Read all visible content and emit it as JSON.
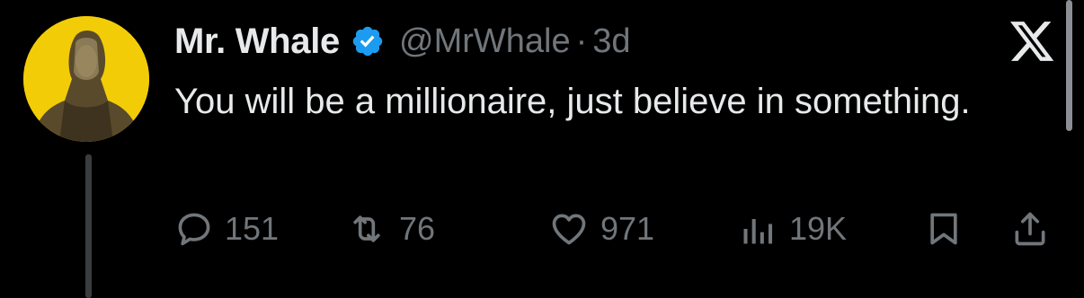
{
  "tweet": {
    "display_name": "Mr. Whale",
    "handle": "@MrWhale",
    "separator": "·",
    "time": "3d",
    "text": "You will be a millionaire, just believe in something.",
    "verified": true
  },
  "actions": {
    "replies": "151",
    "retweets": "76",
    "likes": "971",
    "views": "19K"
  },
  "icons": {
    "verified": "verified-badge-icon",
    "logo": "x-logo-icon",
    "reply": "reply-icon",
    "retweet": "retweet-icon",
    "like": "heart-icon",
    "views": "views-chart-icon",
    "bookmark": "bookmark-icon",
    "share": "share-icon"
  },
  "colors": {
    "background": "#000000",
    "text": "#e7e9ea",
    "muted": "#71767b",
    "verified_blue": "#1d9bf0",
    "avatar_bg": "#f2cd07"
  }
}
